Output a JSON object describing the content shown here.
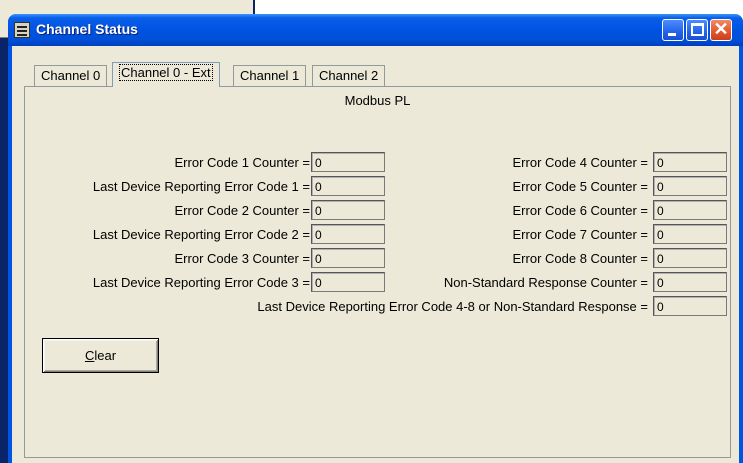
{
  "window": {
    "title": "Channel Status"
  },
  "tabs": [
    {
      "label": "Channel 0",
      "active": false
    },
    {
      "label": "Channel 0 - Ext",
      "active": true
    },
    {
      "label": "Channel 1",
      "active": false
    },
    {
      "label": "Channel 2",
      "active": false
    }
  ],
  "panel": {
    "protocol": "Modbus PL",
    "left_column": [
      {
        "label": "Error Code 1 Counter =",
        "value": "0"
      },
      {
        "label": "Last Device Reporting Error Code 1 =",
        "value": "0"
      },
      {
        "label": "Error Code 2 Counter =",
        "value": "0"
      },
      {
        "label": "Last Device Reporting Error Code 2 =",
        "value": "0"
      },
      {
        "label": "Error Code 3 Counter =",
        "value": "0"
      },
      {
        "label": "Last Device Reporting Error Code 3 =",
        "value": "0"
      }
    ],
    "right_column": [
      {
        "label": "Error Code 4 Counter =",
        "value": "0"
      },
      {
        "label": "Error Code 5 Counter =",
        "value": "0"
      },
      {
        "label": "Error Code 6 Counter =",
        "value": "0"
      },
      {
        "label": "Error Code 7 Counter =",
        "value": "0"
      },
      {
        "label": "Error Code 8 Counter =",
        "value": "0"
      },
      {
        "label": "Non-Standard Response Counter =",
        "value": "0"
      }
    ],
    "bottom_field": {
      "label": "Last Device Reporting Error Code 4-8 or Non-Standard Response =",
      "value": "0"
    },
    "clear_button": {
      "label": "Clear",
      "accesskey": "C"
    }
  },
  "colors": {
    "titlebar": "#0054e3",
    "face": "#ece9d8",
    "close_button": "#e25a30"
  },
  "icons": {
    "app": "channel-status-app-icon",
    "minimize": "minimize-icon",
    "maximize": "maximize-icon",
    "close": "close-icon"
  }
}
